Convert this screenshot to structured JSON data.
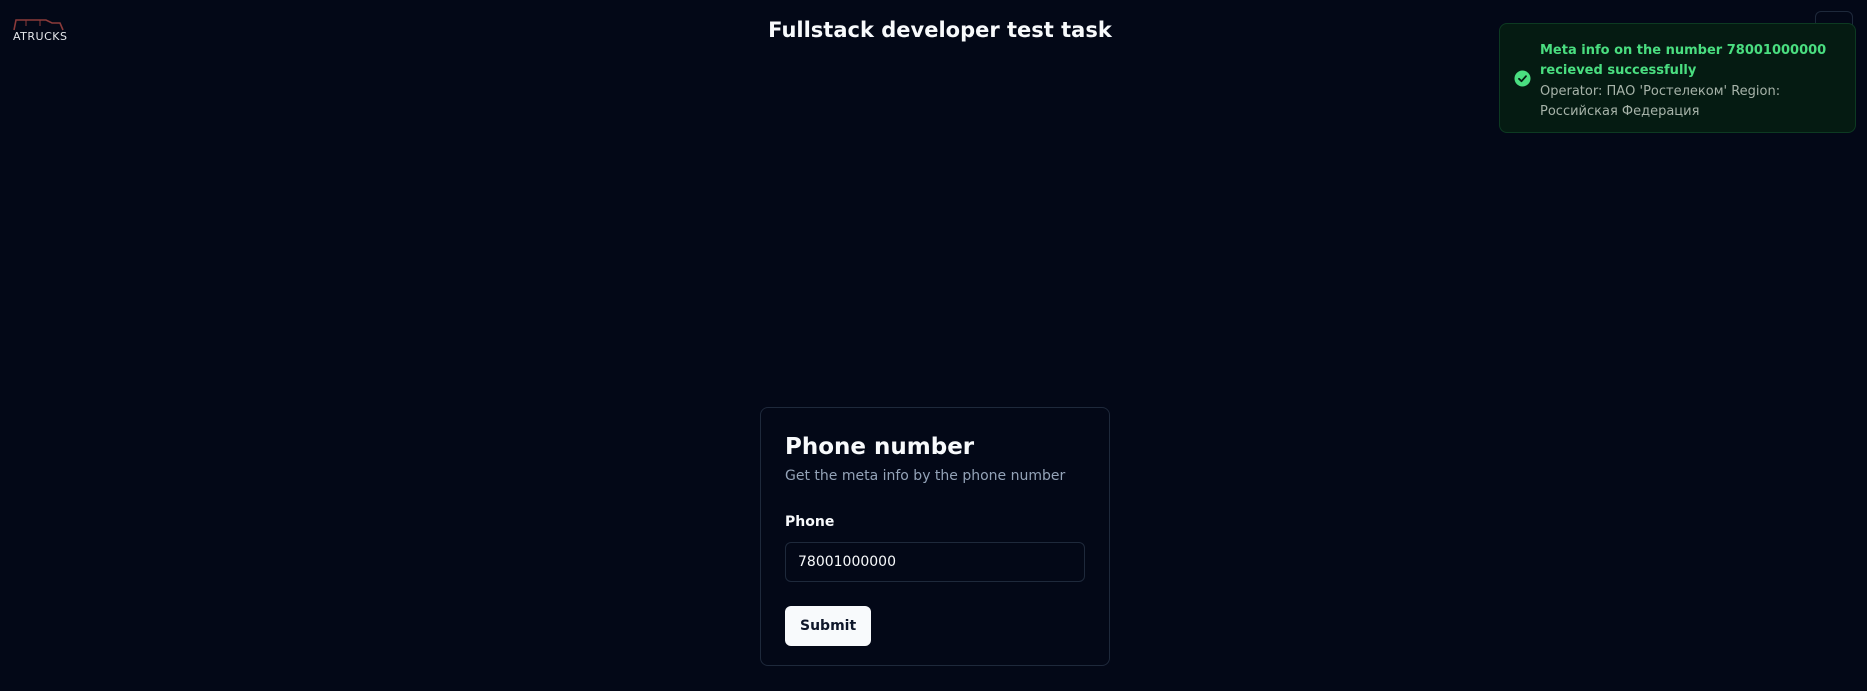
{
  "header": {
    "logo_text": "ATRUCKS",
    "title": "Fullstack developer test task"
  },
  "toast": {
    "title": "Meta info on the number 78001000000 recieved successfully",
    "description": "Operator: ПАО 'Ростелеком' Region: Российская Федерация",
    "status_color": "#4ade80",
    "icon": "check-circle-icon"
  },
  "card": {
    "title": "Phone number",
    "description": "Get the meta info by the phone number",
    "phone_label": "Phone",
    "phone_value": "78001000000",
    "submit_label": "Submit"
  }
}
